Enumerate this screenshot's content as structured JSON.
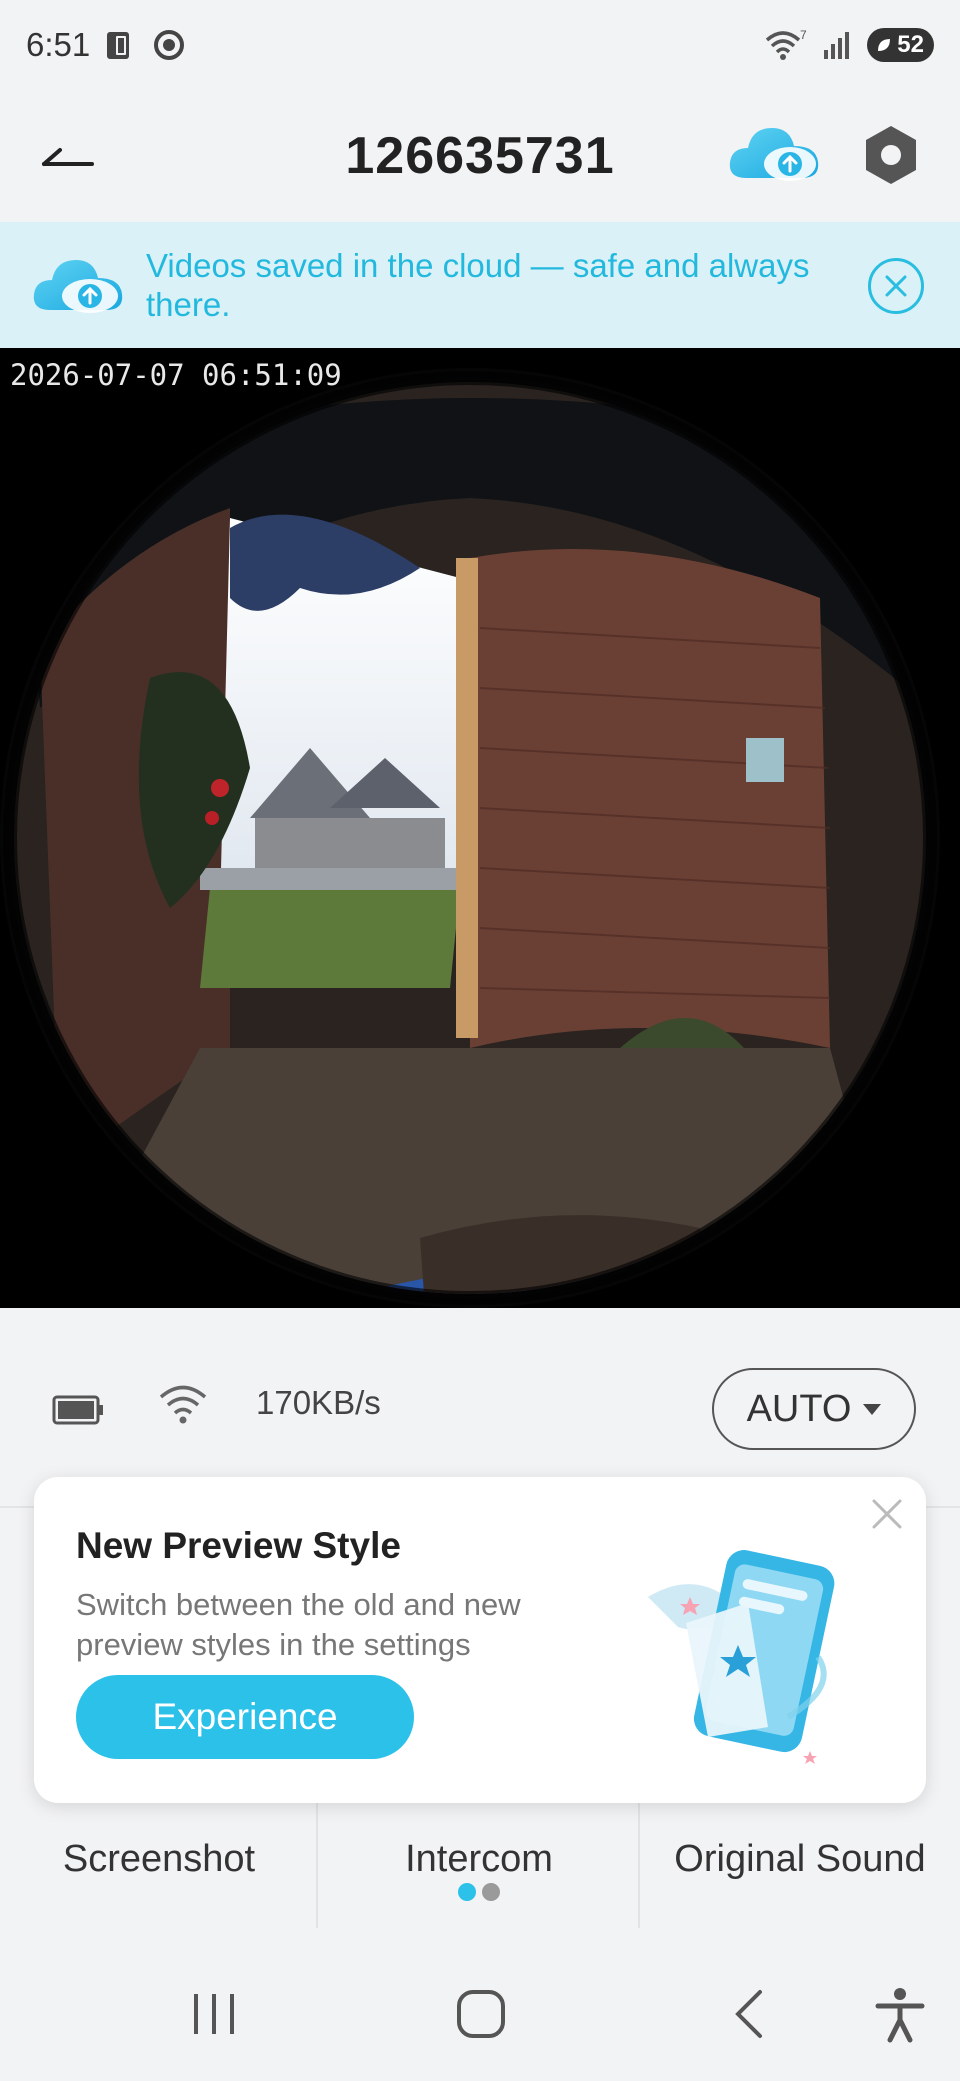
{
  "status_bar": {
    "time": "6:51",
    "network_sup": "7",
    "battery": "52"
  },
  "header": {
    "title": "126635731"
  },
  "banner": {
    "text": "Videos saved in the cloud — safe and always there."
  },
  "video": {
    "timestamp": "2026-07-07 06:51:09"
  },
  "info": {
    "bitrate": "170KB/s",
    "quality": "AUTO"
  },
  "controls": {
    "items": [
      {
        "label": "Screenshot"
      },
      {
        "label": "Intercom"
      },
      {
        "label": "Original Sound"
      }
    ],
    "page_dots": {
      "active_color": "#2cc1e9",
      "inactive_color": "#9a9a9a"
    }
  },
  "popup": {
    "title": "New Preview Style",
    "description": "Switch between the old and new preview styles in the settings",
    "button_label": "Experience"
  },
  "colors": {
    "accent": "#2cc1e9",
    "banner_bg": "#d9f1f7",
    "banner_text": "#23b9de"
  },
  "icons": {
    "back": "back-arrow-icon",
    "cloud_upload": "cloud-upload-icon",
    "settings": "hexagon-settings-icon",
    "banner_close": "circle-close-icon",
    "battery": "battery-icon",
    "wifi": "wifi-icon",
    "popup_close": "close-icon",
    "nav_recents": "recents-icon",
    "nav_home": "home-icon",
    "nav_back": "back-icon",
    "nav_accessibility": "accessibility-icon"
  }
}
